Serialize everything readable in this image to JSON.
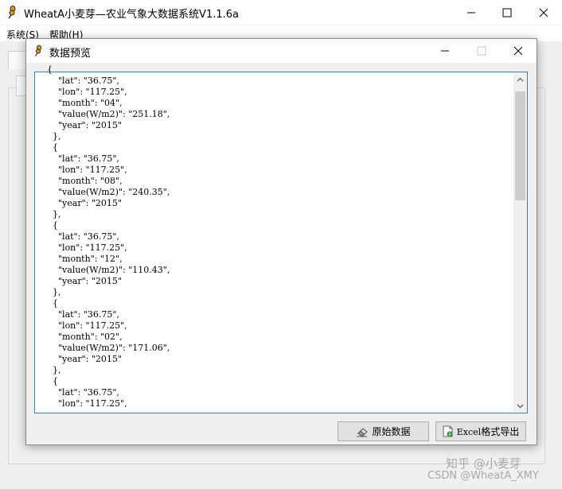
{
  "window": {
    "title": "WheatA小麦芽—农业气象大数据系统V1.1.6a",
    "controls": [
      "minimize-icon",
      "maximize-icon",
      "close-icon"
    ]
  },
  "menu": {
    "items": [
      {
        "label": "系统(S)"
      },
      {
        "label": "帮助(H)"
      }
    ]
  },
  "dialog": {
    "title": "数据预览",
    "lines": [
      "{",
      "    \"lat\": \"36.75\",",
      "    \"lon\": \"117.25\",",
      "    \"month\": \"04\",",
      "    \"value(W/m2)\": \"251.18\",",
      "    \"year\": \"2015\"",
      "  },",
      "  {",
      "    \"lat\": \"36.75\",",
      "    \"lon\": \"117.25\",",
      "    \"month\": \"08\",",
      "    \"value(W/m2)\": \"240.35\",",
      "    \"year\": \"2015\"",
      "  },",
      "  {",
      "    \"lat\": \"36.75\",",
      "    \"lon\": \"117.25\",",
      "    \"month\": \"12\",",
      "    \"value(W/m2)\": \"110.43\",",
      "    \"year\": \"2015\"",
      "  },",
      "  {",
      "    \"lat\": \"36.75\",",
      "    \"lon\": \"117.25\",",
      "    \"month\": \"02\",",
      "    \"value(W/m2)\": \"171.06\",",
      "    \"year\": \"2015\"",
      "  },",
      "  {",
      "    \"lat\": \"36.75\",",
      "    \"lon\": \"117.25\","
    ],
    "buttons": {
      "raw_data": "原始数据",
      "excel_export_prefix": "Excel",
      "excel_export_suffix": "格式导出"
    }
  },
  "watermark": {
    "zhihu": "知乎 @小麦芽",
    "csdn": "CSDN @WheatA_XMY"
  },
  "colors": {
    "accent_border": "#3c7fb1",
    "wheat_icon": "#d4a017"
  }
}
